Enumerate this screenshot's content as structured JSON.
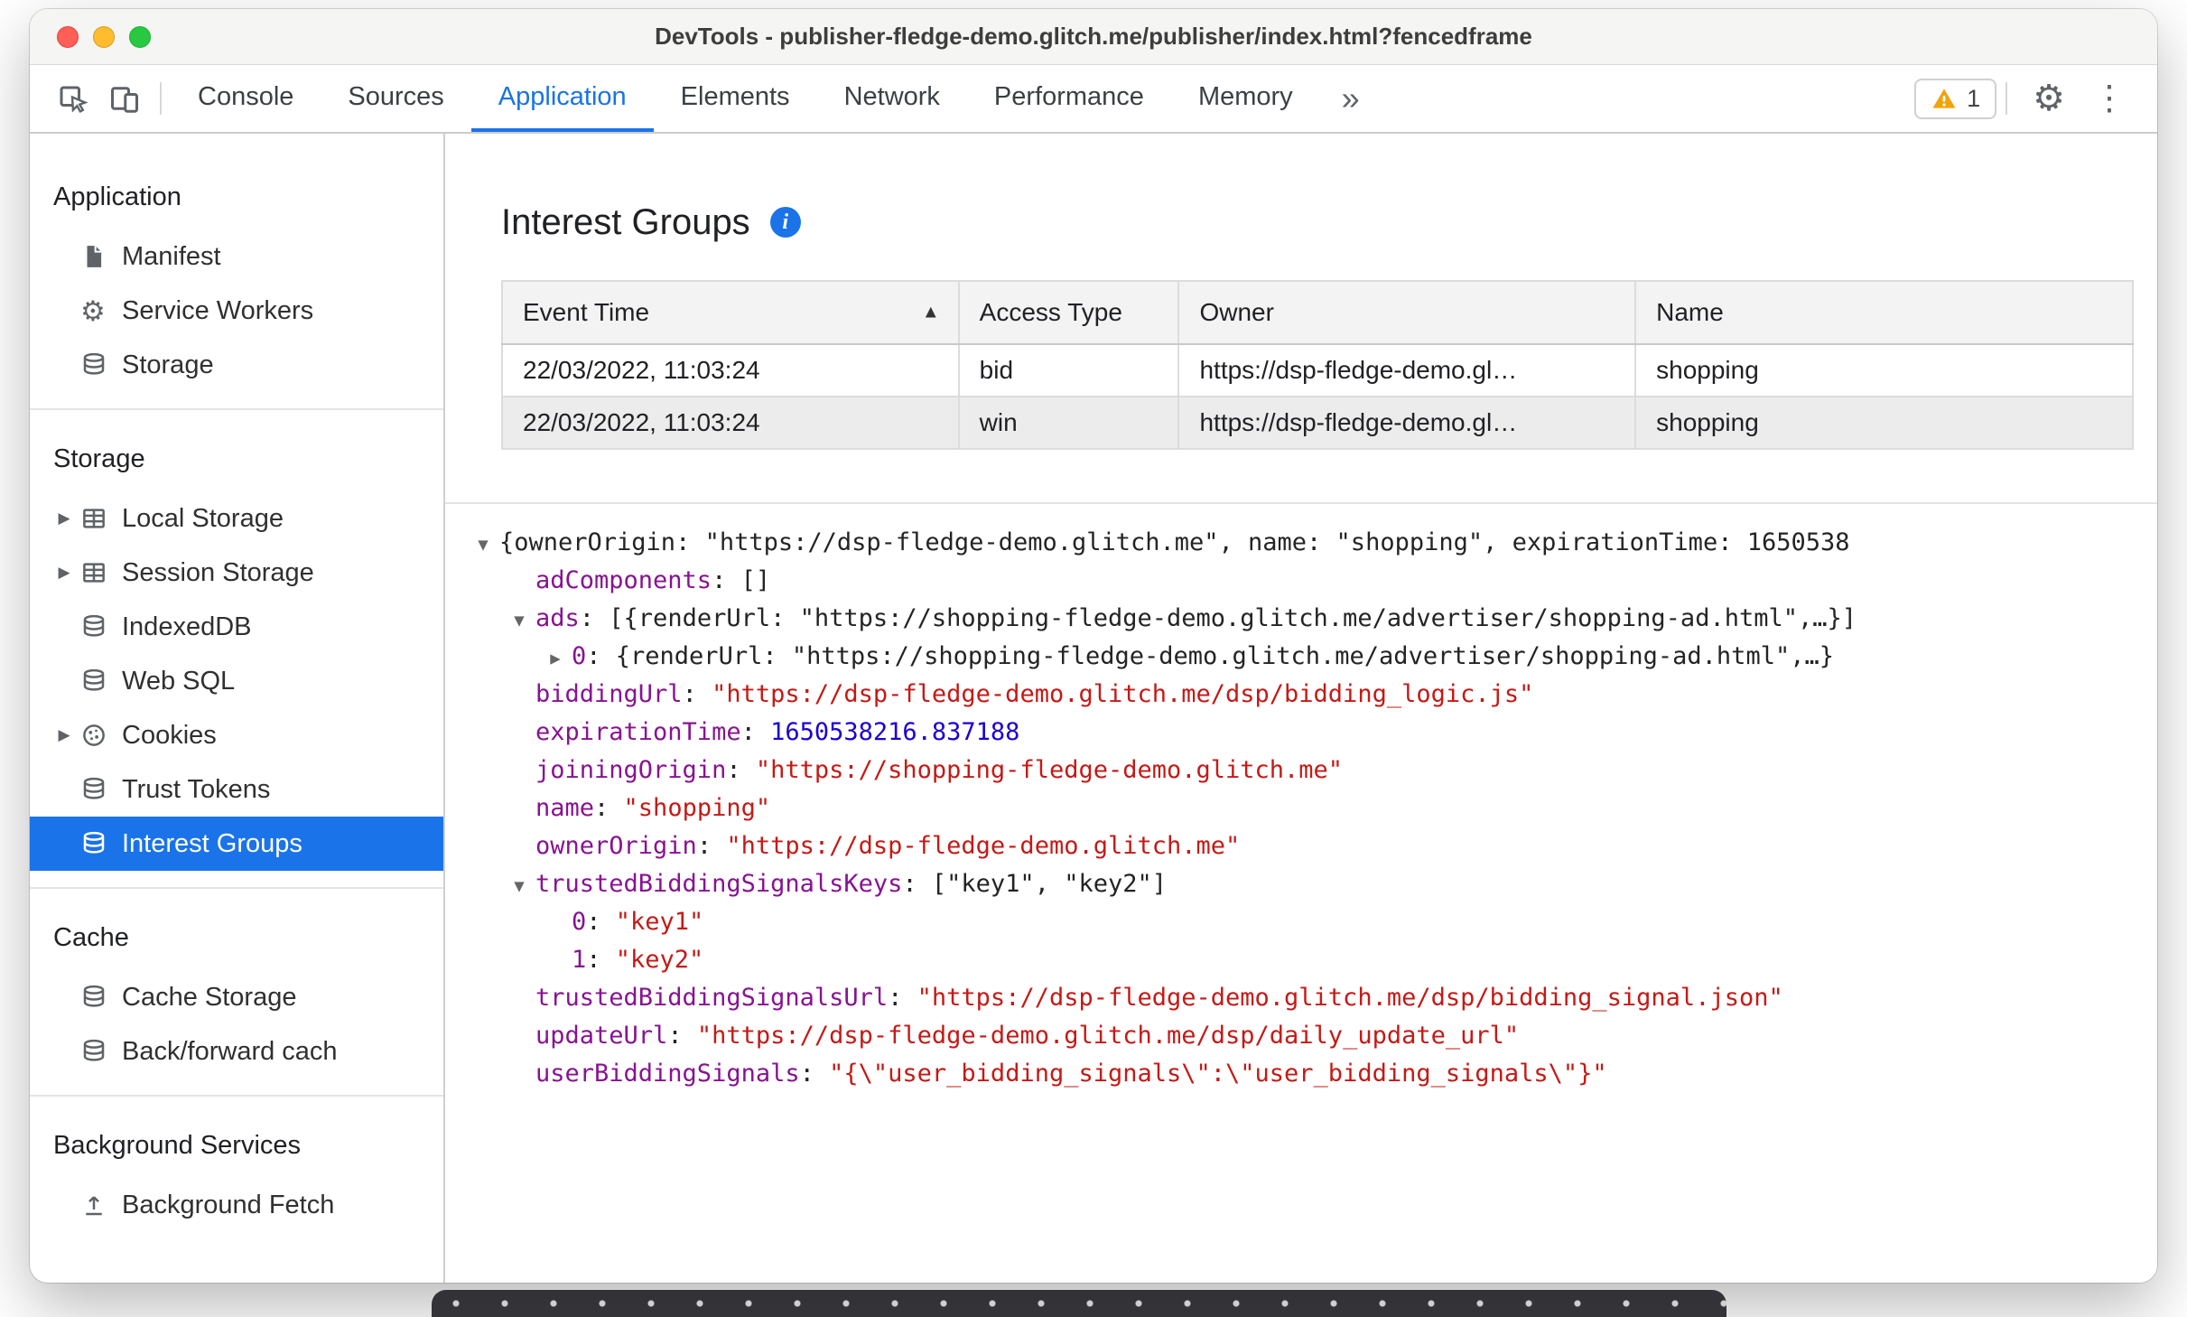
{
  "window": {
    "title": "DevTools - publisher-fledge-demo.glitch.me/publisher/index.html?fencedframe"
  },
  "toolbar": {
    "tabs": [
      {
        "label": "Console",
        "selected": false
      },
      {
        "label": "Sources",
        "selected": false
      },
      {
        "label": "Application",
        "selected": true
      },
      {
        "label": "Elements",
        "selected": false
      },
      {
        "label": "Network",
        "selected": false
      },
      {
        "label": "Performance",
        "selected": false
      },
      {
        "label": "Memory",
        "selected": false
      }
    ],
    "more_tabs_label": "»",
    "warning_count": "1",
    "icons": {
      "inspect": "inspect-icon",
      "device": "device-toolbar-icon",
      "warning": "warning-triangle-icon",
      "settings": "gear-icon",
      "more": "kebab-menu-icon"
    }
  },
  "sidebar": {
    "sections": [
      {
        "title": "Application",
        "items": [
          {
            "label": "Manifest",
            "icon": "document-icon",
            "expandable": false,
            "selected": false
          },
          {
            "label": "Service Workers",
            "icon": "gear-icon",
            "expandable": false,
            "selected": false
          },
          {
            "label": "Storage",
            "icon": "database-icon",
            "expandable": false,
            "selected": false
          }
        ]
      },
      {
        "title": "Storage",
        "items": [
          {
            "label": "Local Storage",
            "icon": "table-icon",
            "expandable": true,
            "selected": false
          },
          {
            "label": "Session Storage",
            "icon": "table-icon",
            "expandable": true,
            "selected": false
          },
          {
            "label": "IndexedDB",
            "icon": "database-icon",
            "expandable": false,
            "selected": false
          },
          {
            "label": "Web SQL",
            "icon": "database-icon",
            "expandable": false,
            "selected": false
          },
          {
            "label": "Cookies",
            "icon": "cookie-icon",
            "expandable": true,
            "selected": false
          },
          {
            "label": "Trust Tokens",
            "icon": "database-icon",
            "expandable": false,
            "selected": false
          },
          {
            "label": "Interest Groups",
            "icon": "database-icon",
            "expandable": false,
            "selected": true
          }
        ]
      },
      {
        "title": "Cache",
        "items": [
          {
            "label": "Cache Storage",
            "icon": "database-icon",
            "expandable": false,
            "selected": false
          },
          {
            "label": "Back/forward cach",
            "icon": "database-icon",
            "expandable": false,
            "selected": false
          }
        ]
      },
      {
        "title": "Background Services",
        "items": [
          {
            "label": "Background Fetch",
            "icon": "fetch-icon",
            "expandable": false,
            "selected": false
          }
        ]
      }
    ]
  },
  "main": {
    "title": "Interest Groups",
    "info_icon": "info-icon",
    "table": {
      "columns": [
        "Event Time",
        "Access Type",
        "Owner",
        "Name"
      ],
      "sorted_column": "Event Time",
      "sort_direction": "ascending",
      "rows": [
        [
          "22/03/2022, 11:03:24",
          "bid",
          "https://dsp-fledge-demo.gl…",
          "shopping"
        ],
        [
          "22/03/2022, 11:03:24",
          "win",
          "https://dsp-fledge-demo.gl…",
          "shopping"
        ]
      ]
    },
    "tree": {
      "lines": [
        {
          "indent": 0,
          "arrow": "down",
          "segments": [
            {
              "c": "p",
              "t": "{ownerOrigin: \"https://dsp-fledge-demo.glitch.me\", name: \"shopping\", expirationTime: 1650538"
            }
          ]
        },
        {
          "indent": 1,
          "arrow": "none",
          "segments": [
            {
              "c": "k",
              "t": "adComponents"
            },
            {
              "c": "p",
              "t": ": []"
            }
          ]
        },
        {
          "indent": 1,
          "arrow": "down",
          "segments": [
            {
              "c": "k",
              "t": "ads"
            },
            {
              "c": "p",
              "t": ": [{renderUrl: \"https://shopping-fledge-demo.glitch.me/advertiser/shopping-ad.html\",…}]"
            }
          ]
        },
        {
          "indent": 2,
          "arrow": "right",
          "segments": [
            {
              "c": "k",
              "t": "0"
            },
            {
              "c": "p",
              "t": ": {renderUrl: \"https://shopping-fledge-demo.glitch.me/advertiser/shopping-ad.html\",…}"
            }
          ]
        },
        {
          "indent": 1,
          "arrow": "none",
          "segments": [
            {
              "c": "k",
              "t": "biddingUrl"
            },
            {
              "c": "p",
              "t": ": "
            },
            {
              "c": "s",
              "t": "\"https://dsp-fledge-demo.glitch.me/dsp/bidding_logic.js\""
            }
          ]
        },
        {
          "indent": 1,
          "arrow": "none",
          "segments": [
            {
              "c": "k",
              "t": "expirationTime"
            },
            {
              "c": "p",
              "t": ": "
            },
            {
              "c": "n",
              "t": "1650538216.837188"
            }
          ]
        },
        {
          "indent": 1,
          "arrow": "none",
          "segments": [
            {
              "c": "k",
              "t": "joiningOrigin"
            },
            {
              "c": "p",
              "t": ": "
            },
            {
              "c": "s",
              "t": "\"https://shopping-fledge-demo.glitch.me\""
            }
          ]
        },
        {
          "indent": 1,
          "arrow": "none",
          "segments": [
            {
              "c": "k",
              "t": "name"
            },
            {
              "c": "p",
              "t": ": "
            },
            {
              "c": "s",
              "t": "\"shopping\""
            }
          ]
        },
        {
          "indent": 1,
          "arrow": "none",
          "segments": [
            {
              "c": "k",
              "t": "ownerOrigin"
            },
            {
              "c": "p",
              "t": ": "
            },
            {
              "c": "s",
              "t": "\"https://dsp-fledge-demo.glitch.me\""
            }
          ]
        },
        {
          "indent": 1,
          "arrow": "down",
          "segments": [
            {
              "c": "k",
              "t": "trustedBiddingSignalsKeys"
            },
            {
              "c": "p",
              "t": ": [\"key1\", \"key2\"]"
            }
          ]
        },
        {
          "indent": 2,
          "arrow": "none",
          "segments": [
            {
              "c": "k",
              "t": "0"
            },
            {
              "c": "p",
              "t": ": "
            },
            {
              "c": "s",
              "t": "\"key1\""
            }
          ]
        },
        {
          "indent": 2,
          "arrow": "none",
          "segments": [
            {
              "c": "k",
              "t": "1"
            },
            {
              "c": "p",
              "t": ": "
            },
            {
              "c": "s",
              "t": "\"key2\""
            }
          ]
        },
        {
          "indent": 1,
          "arrow": "none",
          "segments": [
            {
              "c": "k",
              "t": "trustedBiddingSignalsUrl"
            },
            {
              "c": "p",
              "t": ": "
            },
            {
              "c": "s",
              "t": "\"https://dsp-fledge-demo.glitch.me/dsp/bidding_signal.json\""
            }
          ]
        },
        {
          "indent": 1,
          "arrow": "none",
          "segments": [
            {
              "c": "k",
              "t": "updateUrl"
            },
            {
              "c": "p",
              "t": ": "
            },
            {
              "c": "s",
              "t": "\"https://dsp-fledge-demo.glitch.me/dsp/daily_update_url\""
            }
          ]
        },
        {
          "indent": 1,
          "arrow": "none",
          "segments": [
            {
              "c": "k",
              "t": "userBiddingSignals"
            },
            {
              "c": "p",
              "t": ": "
            },
            {
              "c": "s",
              "t": "\"{\\\"user_bidding_signals\\\":\\\"user_bidding_signals\\\"}\""
            }
          ]
        }
      ]
    }
  },
  "colors": {
    "accent_blue": "#1a73e8",
    "selection_bg": "#1a73e8",
    "tree_key_purple": "#881391",
    "tree_string_red": "#c41a16",
    "tree_number_blue": "#1c00cf",
    "warning_yellow": "#f0a30a"
  }
}
